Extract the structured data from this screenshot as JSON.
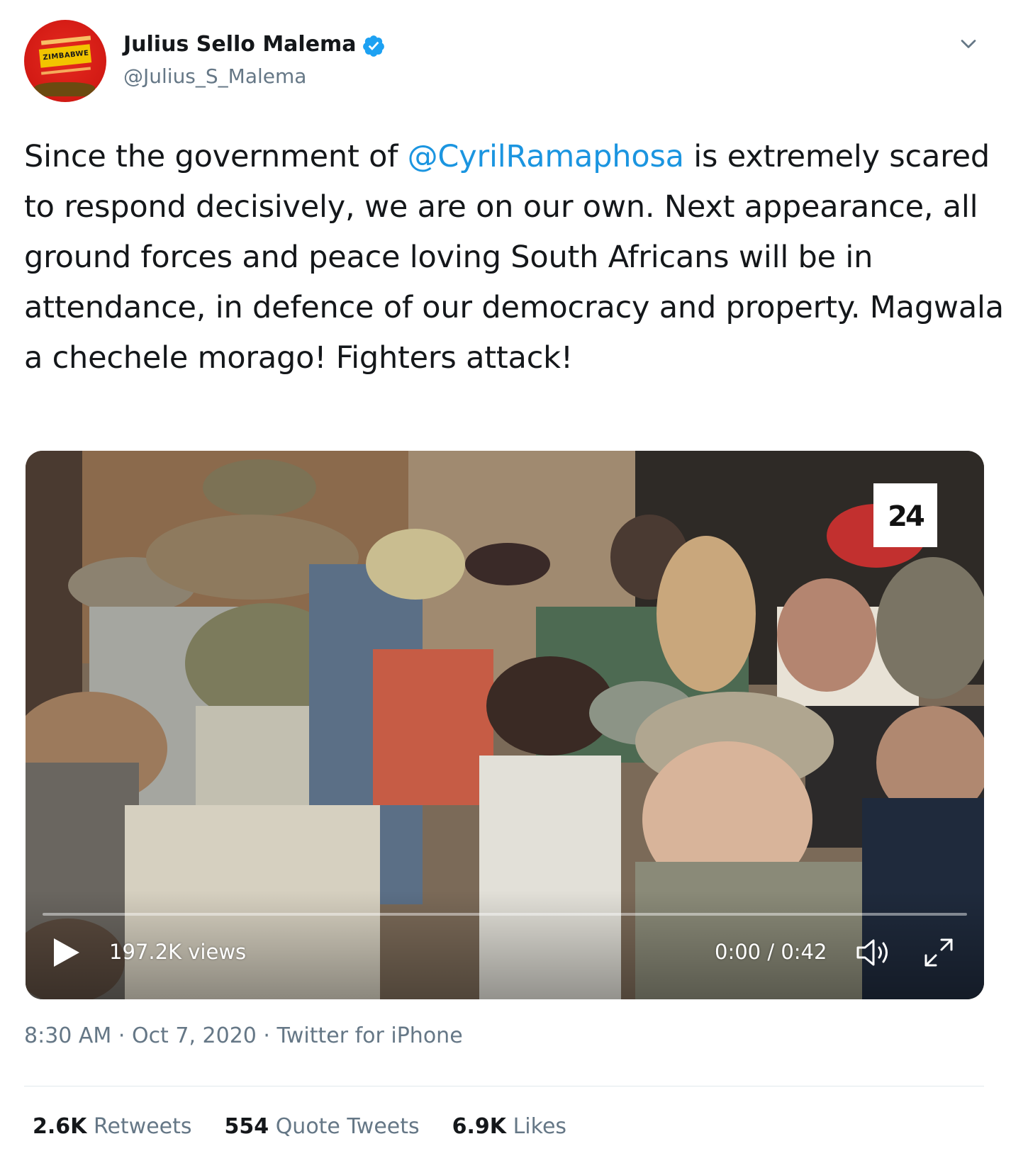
{
  "author": {
    "display_name": "Julius Sello Malema",
    "handle": "@Julius_S_Malema",
    "avatar_text": "ZIMBABWE",
    "verified": true
  },
  "tweet": {
    "text_before_mention": "Since the government of ",
    "mention": "@CyrilRamaphosa",
    "text_after_mention": " is extremely scared to respond decisively, we are on our own. Next appearance, all ground forces and peace loving South Africans will be in attendance, in defence of our democracy and property. Magwala a chechele morago! Fighters attack!"
  },
  "video": {
    "watermark": "24",
    "views": "197.2K views",
    "time": "0:00 / 0:42",
    "progress": 0,
    "icons": [
      "play-icon",
      "volume-icon",
      "expand-icon"
    ]
  },
  "meta": {
    "time": "8:30 AM",
    "separator": "·",
    "date": "Oct 7, 2020",
    "source": "Twitter for iPhone"
  },
  "stats": {
    "retweets_count": "2.6K",
    "retweets_label": "Retweets",
    "quotes_count": "554",
    "quotes_label": "Quote Tweets",
    "likes_count": "6.9K",
    "likes_label": "Likes"
  },
  "colors": {
    "link": "#1b95e0",
    "verified": "#1da1f2",
    "secondary_text": "#657786"
  }
}
